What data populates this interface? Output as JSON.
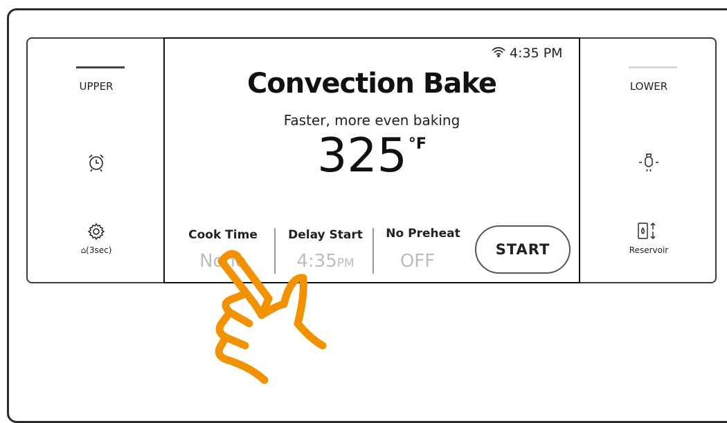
{
  "status": {
    "time": "4:35 PM",
    "wifi_icon": "wifi-icon"
  },
  "left_panel": {
    "oven_label": "UPPER",
    "timer_icon": "alarm-clock-icon",
    "settings_icon": "gear-icon",
    "lock_label": "⌂(3sec)"
  },
  "right_panel": {
    "oven_label": "LOWER",
    "light_icon": "oven-light-icon",
    "reservoir_icon": "reservoir-icon",
    "reservoir_label": "Reservoir"
  },
  "mode": {
    "title": "Convection Bake",
    "subtitle": "Faster, more even baking",
    "temperature": "325",
    "unit": "°F"
  },
  "options": [
    {
      "label": "Cook Time",
      "value": "None",
      "suffix": ""
    },
    {
      "label": "Delay Start",
      "value": "4:35",
      "suffix": "PM"
    },
    {
      "label": "No Preheat",
      "value": "OFF",
      "suffix": ""
    }
  ],
  "start_button": {
    "label": "START"
  },
  "colors": {
    "hand": "#f39200",
    "inactive_value": "#bdbdbd"
  }
}
